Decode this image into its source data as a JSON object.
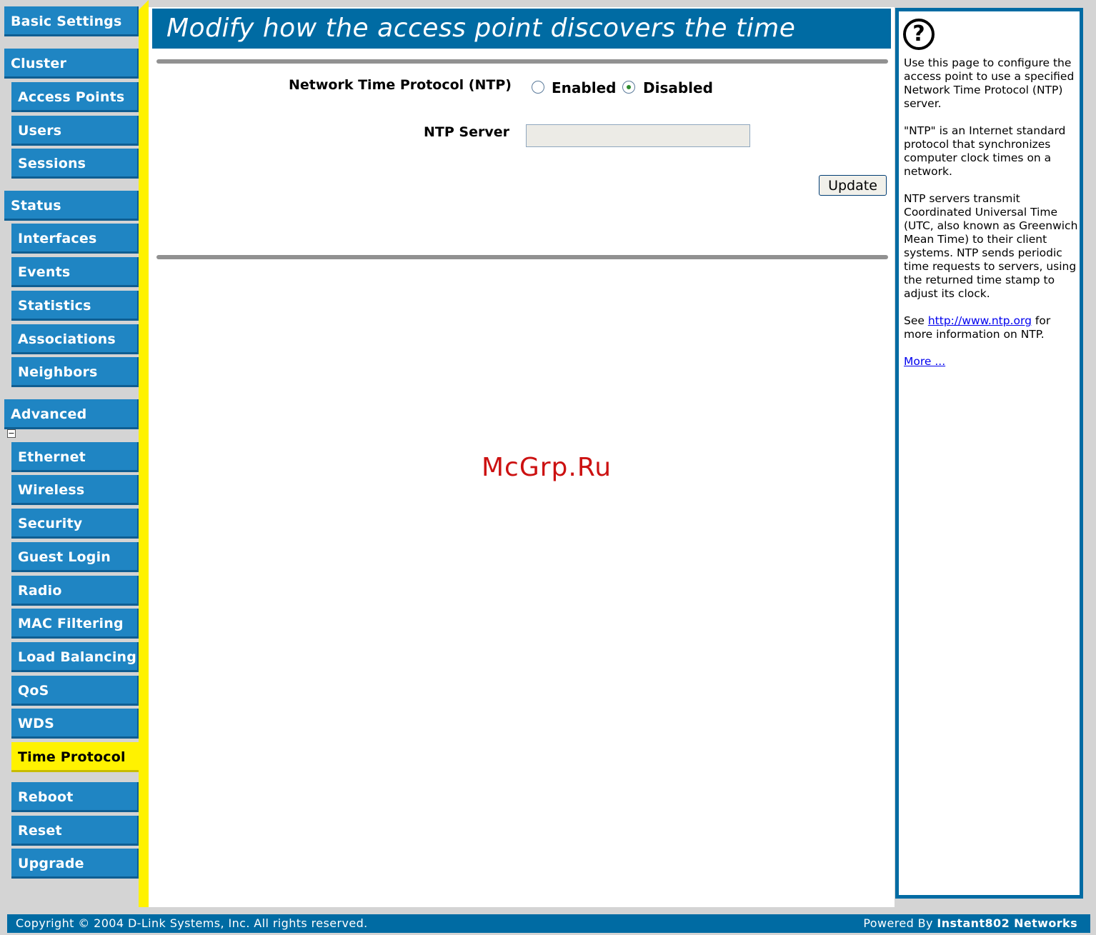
{
  "sidebar": {
    "basic_settings": "Basic Settings",
    "cluster": "Cluster",
    "access_points": "Access Points",
    "users": "Users",
    "sessions": "Sessions",
    "status": "Status",
    "interfaces": "Interfaces",
    "events": "Events",
    "statistics": "Statistics",
    "associations": "Associations",
    "neighbors": "Neighbors",
    "advanced": "Advanced",
    "collapse": "−",
    "ethernet": "Ethernet",
    "wireless": "Wireless",
    "security": "Security",
    "guest_login": "Guest Login",
    "radio": "Radio",
    "mac_filtering": "MAC Filtering",
    "load_balancing": "Load Balancing",
    "qos": "QoS",
    "wds": "WDS",
    "time_protocol": "Time Protocol",
    "reboot": "Reboot",
    "reset": "Reset",
    "upgrade": "Upgrade"
  },
  "main": {
    "title": "Modify how the access point discovers the time",
    "ntp_label": "Network Time Protocol (NTP)",
    "enabled_label": "Enabled",
    "disabled_label": "Disabled",
    "ntp_state": "Disabled",
    "server_label": "NTP Server",
    "server_value": "",
    "update_label": "Update",
    "watermark": "McGrp.Ru"
  },
  "help": {
    "icon": "?",
    "p1": "Use this page to configure the access point to use a specified Network Time Protocol (NTP) server.",
    "p2": "\"NTP\" is an Internet standard protocol that synchronizes computer clock times on a network.",
    "p3": "NTP servers transmit Coordinated Universal Time (UTC, also known as Greenwich Mean Time) to their client systems. NTP sends periodic time requests to servers, using the returned time stamp to adjust its clock.",
    "p4_pre": "See ",
    "p4_link": "http://www.ntp.org",
    "p4_post": " for more information on NTP.",
    "more": "More ..."
  },
  "footer": {
    "copyright": "Copyright © 2004 D-Link Systems, Inc. All rights reserved.",
    "powered_pre": "Powered By ",
    "powered_brand": "Instant802 Networks"
  },
  "colors": {
    "nav_blue": "#1f85c3",
    "title_blue": "#006ba3",
    "active_yellow": "#fff200"
  }
}
